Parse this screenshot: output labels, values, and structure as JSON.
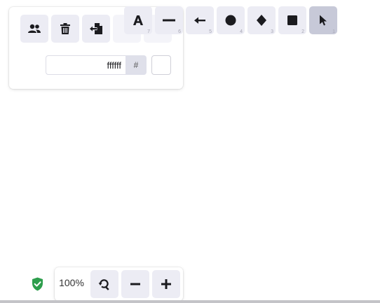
{
  "menu": {
    "buttons": [
      {
        "icon": "users-icon"
      },
      {
        "icon": "trash-icon"
      },
      {
        "icon": "export-icon"
      },
      {
        "icon": "hidden-button-icon"
      },
      {
        "icon": "hidden-button-icon"
      }
    ],
    "background_color": {
      "value": "ffffff",
      "hash_label": "#",
      "swatch": "#ffffff"
    }
  },
  "tools": [
    {
      "name": "text",
      "key": "7",
      "icon": "text-tool-icon"
    },
    {
      "name": "line",
      "key": "6",
      "icon": "line-tool-icon"
    },
    {
      "name": "arrow",
      "key": "5",
      "icon": "arrow-tool-icon"
    },
    {
      "name": "ellipse",
      "key": "4",
      "icon": "circle-tool-icon"
    },
    {
      "name": "diamond",
      "key": "3",
      "icon": "diamond-tool-icon"
    },
    {
      "name": "rectangle",
      "key": "2",
      "icon": "square-tool-icon"
    },
    {
      "name": "selection",
      "key": "1",
      "icon": "pointer-tool-icon",
      "active": true
    }
  ],
  "zoom": {
    "label": "100%"
  },
  "colors": {
    "button_bg": "#ececf4",
    "active_bg": "#c7c9d8",
    "shield": "#2e9e4d"
  }
}
